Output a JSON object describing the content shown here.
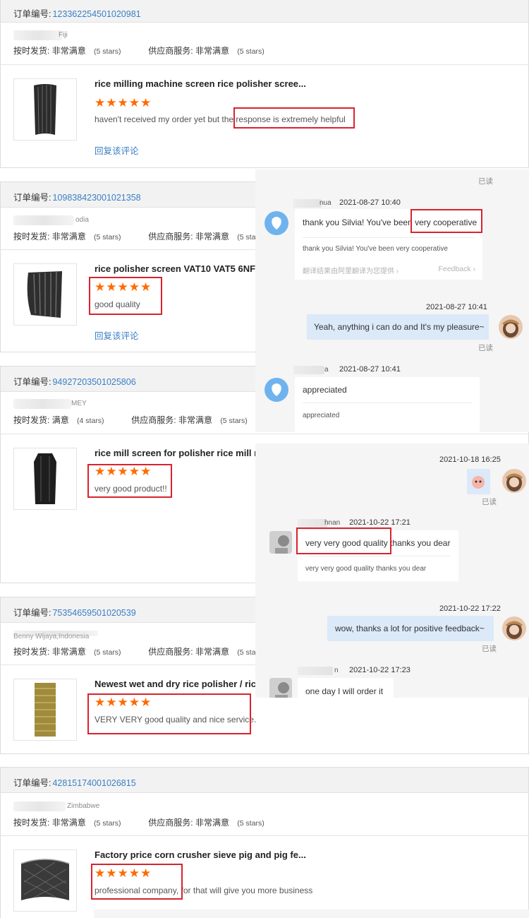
{
  "labels": {
    "order_no": "订单编号:",
    "ontime": "按时发货:",
    "supplier": "供应商服务:",
    "reply": "回复该评论"
  },
  "orders": [
    {
      "order_no": "123362254501020981",
      "country": "Fiji",
      "ontime_rating": "非常满意",
      "ontime_stars": "(5 stars)",
      "supplier_rating": "非常满意",
      "supplier_stars": "(5 stars)",
      "product_title": "rice milling machine screen rice polisher scree...",
      "review_prefix": "haven't received my order yet but the ",
      "review_highlight": "response is extremely helpful",
      "reply": "回复该评论"
    },
    {
      "order_no": "109838423001021358",
      "country": "odia",
      "ontime_rating": "非常满意",
      "ontime_stars": "(5 stars)",
      "supplier_rating": "非常满意",
      "supplier_stars": "(5 star",
      "product_title": "rice polisher screen VAT10 VAT5 6NF",
      "review": "good quality",
      "reply": "回复该评论"
    },
    {
      "order_no": "94927203501025806",
      "country": "MEY",
      "ontime_rating": "满意",
      "ontime_stars": "(4 stars)",
      "supplier_rating": "非常满意",
      "supplier_stars": "(5 stars)",
      "product_title": "rice mill screen for polisher rice mill r",
      "review": "very good product!!"
    },
    {
      "order_no": "75354659501020539",
      "country": "Benny Wijaya,Indonesia",
      "ontime_rating": "非常满意",
      "ontime_stars": "(5 stars)",
      "supplier_rating": "非常满意",
      "supplier_stars": "(5 star",
      "product_title": "Newest wet and dry rice polisher / ric",
      "review": "VERY VERY good quality and nice service."
    },
    {
      "order_no": "42815174001026815",
      "country": "Zimbabwe",
      "ontime_rating": "非常满意",
      "ontime_stars": "(5 stars)",
      "supplier_rating": "非常满意",
      "supplier_stars": "(5 stars)",
      "product_title": "Factory price corn crusher sieve pig and pig fe...",
      "review_highlight": "professional company,",
      "review_suffix": " for that will give you more business"
    }
  ],
  "stars_glyph": "★★★★★",
  "colors": {
    "accent": "#ff6a00",
    "link": "#3a7fc4",
    "highlight": "#d9232d",
    "my_bubble": "#dbe9f8"
  },
  "chat1": {
    "read_top": "已读",
    "m1": {
      "name_tail": "nua",
      "time": "2021-08-27 10:40",
      "text_prefix": "thank you Silvia! You've been ",
      "text_highlight": "very cooperative",
      "translation": "thank you Silvia! You've been very cooperative",
      "foot": "翻译结果由阿里翻译为您提供 ›",
      "feedback": "Feedback ›"
    },
    "m2": {
      "time": "2021-08-27 10:41",
      "text": "Yeah, anything i can do and It's my pleasure~",
      "read": "已读"
    },
    "m3": {
      "name_tail": "a",
      "time": "2021-08-27 10:41",
      "text": "appreciated",
      "translation": "appreciated"
    }
  },
  "chat2": {
    "m1": {
      "time": "2021-10-18 16:25",
      "read": "已读"
    },
    "m2": {
      "name_tail": "hnan",
      "time": "2021-10-22 17:21",
      "text_highlight": "very very good quality",
      "text_suffix": " thanks you dear",
      "translation": "very very good quality thanks you dear"
    },
    "m3": {
      "time": "2021-10-22 17:22",
      "text": "wow, thanks a lot for positive feedback~",
      "read": "已读"
    },
    "m4": {
      "name_tail": "n",
      "time": "2021-10-22 17:23",
      "text": "one day I will order it"
    }
  }
}
